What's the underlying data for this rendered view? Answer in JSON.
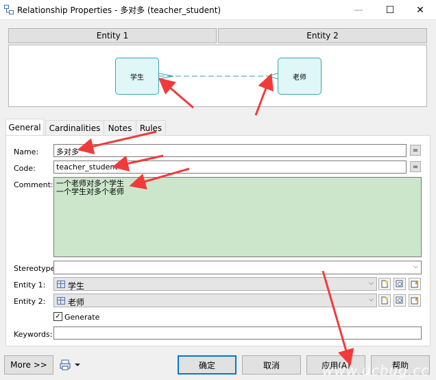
{
  "window": {
    "title": "Relationship Properties - 多对多 (teacher_student)",
    "app_icon": "relationship-icon",
    "minimize_glyph": "—",
    "maximize_glyph": "☐",
    "close_glyph": "✕"
  },
  "entity_headers": {
    "entity1": "Entity 1",
    "entity2": "Entity 2"
  },
  "diagram": {
    "entity1_name": "学生",
    "entity2_name": "老师",
    "line_color": "#32a6b0"
  },
  "tabs": [
    {
      "label": "General",
      "active": true
    },
    {
      "label": "Cardinalities",
      "active": false
    },
    {
      "label": "Notes",
      "active": false
    },
    {
      "label": "Rules",
      "active": false
    }
  ],
  "form": {
    "name_label": "Name:",
    "name_value": "多对多",
    "code_label": "Code:",
    "code_value": "teacher_student",
    "equals_glyph": "=",
    "comment_label": "Comment:",
    "comment_lines": [
      "一个老师对多个学生",
      "一个学生对多个老师"
    ],
    "stereotype_label": "Stereotype:",
    "stereotype_value": "",
    "entity1_label": "Entity 1:",
    "entity1_value": "学生",
    "entity2_label": "Entity 2:",
    "entity2_value": "老师",
    "generate_label": "Generate",
    "generate_checked": true,
    "keywords_label": "Keywords:",
    "keywords_value": "",
    "chevron_glyph": "⌵"
  },
  "buttons": {
    "more": "More >>",
    "ok": "确定",
    "cancel": "取消",
    "apply": "应用(A)",
    "help": "帮助"
  },
  "watermark": "www.ucbug.cc",
  "colors": {
    "comment_bg": "#cbe6cb",
    "annotation_arrow": "#f23a3a",
    "entity_fill": "#dff7f7"
  }
}
